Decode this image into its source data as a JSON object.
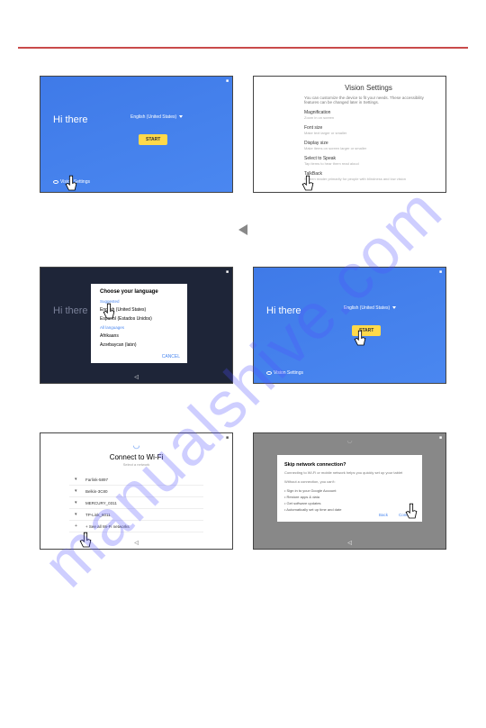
{
  "watermark": "manualshive.com",
  "s1": {
    "greeting": "Hi there",
    "lang_label": "English (United States)",
    "start": "START",
    "vision": "Vision Settings"
  },
  "s2": {
    "title": "Vision Settings",
    "sub": "You can customize the device to fit your needs. These accessibility features can be changed later in Settings.",
    "items": [
      {
        "h": "Magnification",
        "s": "Zoom in on screen"
      },
      {
        "h": "Font size",
        "s": "Make text larger or smaller"
      },
      {
        "h": "Display size",
        "s": "Make items on screen larger or smaller"
      },
      {
        "h": "Select to Speak",
        "s": "Tap items to hear them read aloud"
      },
      {
        "h": "TalkBack",
        "s": "Screen reader primarily for people with blindness and low vision"
      }
    ]
  },
  "s3": {
    "title": "Choose your language",
    "sec1": "Suggested",
    "opt1": "English (United States)",
    "opt2": "Español (Estados Unidos)",
    "sec2": "All languages",
    "opt3": "Afrikaans",
    "opt4": "Azərbaycan (latın)",
    "cancel": "CANCEL",
    "greeting": "Hi there"
  },
  "s4": {
    "greeting": "Hi there",
    "lang_label": "English (United States)",
    "start": "START",
    "vision": "Vision Settings"
  },
  "s5": {
    "title": "Connect to Wi-Fi",
    "sub": "Select a network",
    "nets": [
      "Farlink-5897",
      "Belkin-3C80",
      "MERCURY_0311",
      "TP-Link_6011",
      "+ See all Wi-Fi networks"
    ]
  },
  "s6": {
    "title": "Skip network connection?",
    "sub": "Connecting to Wi-Fi or mobile network helps you quickly set up your tablet",
    "lead": "Without a connection, you can't:",
    "items": [
      "Sign in to your Google Account",
      "Restore apps & data",
      "Get software updates",
      "Automatically set up time and date"
    ],
    "back": "Back",
    "cont": "Continue"
  }
}
